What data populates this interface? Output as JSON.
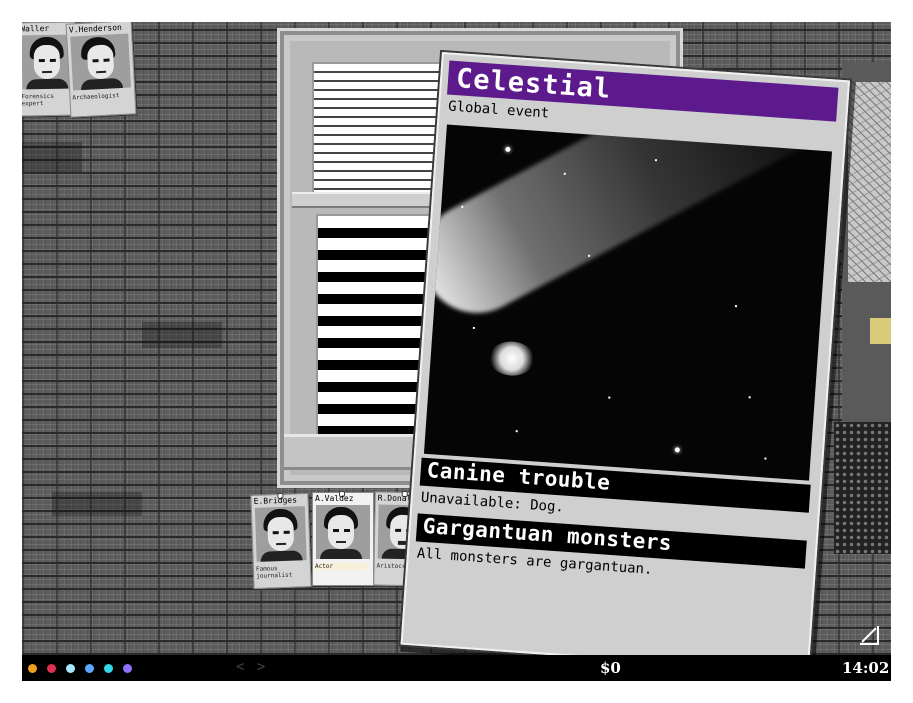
{
  "event_card": {
    "title": "Celestial",
    "subtitle": "Global event",
    "title_color": "#5c1a8c",
    "image": "comet-photo",
    "effects": [
      {
        "name": "Canine trouble",
        "description": "Unavailable: Dog."
      },
      {
        "name": "Gargantuan monsters",
        "description": "All monsters are gargantuan."
      }
    ]
  },
  "characters_top": [
    {
      "name": "Waller",
      "role": "Forensics\nexpert"
    },
    {
      "name": "V.Henderson",
      "role": "Archaeologist"
    }
  ],
  "characters_bottom": [
    {
      "name": "E.Bridges",
      "role": "Famous\njournalist"
    },
    {
      "name": "A.Valdez",
      "role": "Actor"
    },
    {
      "name": "R.Donaldson",
      "role": "Aristocrat"
    }
  ],
  "status_bar": {
    "dots": [
      "#f0a020",
      "#e03050",
      "#a8e8ff",
      "#5aa8ff",
      "#30d8e8",
      "#9070ff"
    ],
    "nav": "< >",
    "money": "$0",
    "clock": "14:02"
  }
}
